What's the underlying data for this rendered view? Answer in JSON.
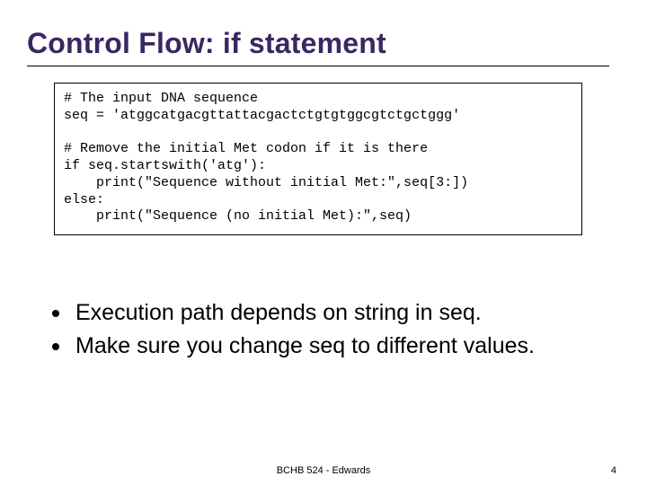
{
  "title": "Control Flow: if statement",
  "code": "# The input DNA sequence\nseq = 'atggcatgacgttattacgactctgtgtggcgtctgctggg'\n\n# Remove the initial Met codon if it is there\nif seq.startswith('atg'):\n    print(\"Sequence without initial Met:\",seq[3:])\nelse:\n    print(\"Sequence (no initial Met):\",seq)",
  "bullets": [
    "Execution path depends on string in seq.",
    "Make sure you change seq to different values."
  ],
  "footer": {
    "center": "BCHB 524 - Edwards",
    "page": "4"
  }
}
